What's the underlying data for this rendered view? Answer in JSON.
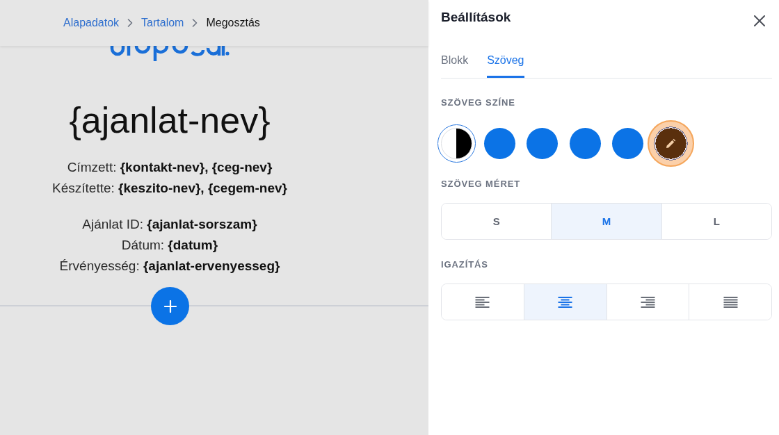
{
  "breadcrumb": [
    {
      "label": "Alapadatok",
      "current": false
    },
    {
      "label": "Tartalom",
      "current": false
    },
    {
      "label": "Megosztás",
      "current": true
    }
  ],
  "document": {
    "title": "{ajanlat-nev}",
    "recipient_lines": [
      "Címzett: **{kontakt-nev}, {ceg-nev}**",
      "Készítette: **{keszito-nev}, {cegem-nev}**"
    ],
    "meta_lines": [
      "Ajánlat ID: **{ajanlat-sorszam}**",
      "Dátum: **{datum}**",
      "Érvényesség: **{ajanlat-ervenyesseg}**"
    ]
  },
  "settings": {
    "title": "Beállítások",
    "tabs": [
      {
        "label": "Blokk",
        "selected": false
      },
      {
        "label": "Szöveg",
        "selected": true
      }
    ],
    "text_color": {
      "label": "SZÖVEG SZÍNE",
      "swatches": [
        {
          "kind": "contrast",
          "selected": false
        },
        {
          "kind": "solid",
          "color": "#0b73e6",
          "selected": false
        },
        {
          "kind": "solid",
          "color": "#0b73e6",
          "selected": false
        },
        {
          "kind": "solid",
          "color": "#0b73e6",
          "selected": false
        },
        {
          "kind": "solid",
          "color": "#0b73e6",
          "selected": false
        },
        {
          "kind": "custom",
          "color": "#5a2f0d",
          "selected": true
        }
      ]
    },
    "text_size": {
      "label": "SZÖVEG MÉRET",
      "options": [
        {
          "label": "S",
          "selected": false
        },
        {
          "label": "M",
          "selected": true
        },
        {
          "label": "L",
          "selected": false
        }
      ]
    },
    "alignment": {
      "label": "IGAZÍTÁS",
      "options": [
        {
          "kind": "left",
          "selected": false
        },
        {
          "kind": "center",
          "selected": true
        },
        {
          "kind": "right",
          "selected": false
        },
        {
          "kind": "justify",
          "selected": false
        }
      ]
    }
  }
}
